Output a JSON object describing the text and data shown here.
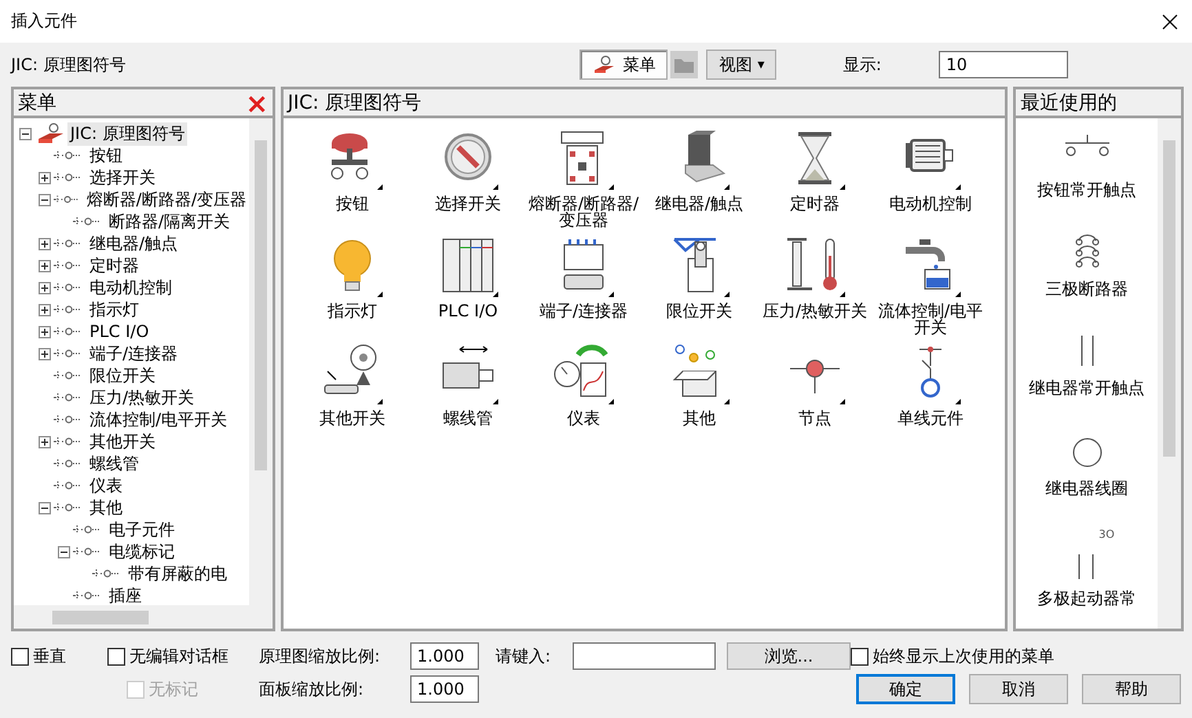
{
  "window": {
    "title": "插入元件"
  },
  "toolbar": {
    "library": "JIC: 原理图符号",
    "menu_button": {
      "label": "菜单",
      "selected": true
    },
    "view_button": {
      "label": "视图",
      "arrow": "▾"
    },
    "display": {
      "label": "显示:",
      "value": "10"
    }
  },
  "menu_panel": {
    "title": "菜单",
    "close": "×",
    "tree": [
      {
        "label": "JIC: 原理图符号",
        "expanded": true,
        "selected": true,
        "children": [
          {
            "label": "按钮"
          },
          {
            "label": "选择开关",
            "expanded": false
          },
          {
            "label": "熔断器/断路器/变压器",
            "expanded": true,
            "children": [
              {
                "label": "断路器/隔离开关"
              }
            ]
          },
          {
            "label": "继电器/触点",
            "expanded": false
          },
          {
            "label": "定时器",
            "expanded": false
          },
          {
            "label": "电动机控制",
            "expanded": false
          },
          {
            "label": "指示灯",
            "expanded": false
          },
          {
            "label": "PLC I/O",
            "expanded": false
          },
          {
            "label": "端子/连接器",
            "expanded": false
          },
          {
            "label": "限位开关"
          },
          {
            "label": "压力/热敏开关"
          },
          {
            "label": "流体控制/电平开关"
          },
          {
            "label": "其他开关",
            "expanded": false
          },
          {
            "label": "螺线管"
          },
          {
            "label": "仪表"
          },
          {
            "label": "其他",
            "expanded": true,
            "children": [
              {
                "label": "电子元件"
              },
              {
                "label": "电缆标记",
                "expanded": true,
                "children": [
                  {
                    "label": "带有屏蔽的电"
                  }
                ]
              },
              {
                "label": "插座"
              }
            ]
          }
        ]
      }
    ]
  },
  "symbols_panel": {
    "title": "JIC: 原理图符号",
    "items": [
      {
        "label": "按钮"
      },
      {
        "label": "选择开关"
      },
      {
        "label": "熔断器/断路器/变压器"
      },
      {
        "label": "继电器/触点"
      },
      {
        "label": "定时器"
      },
      {
        "label": "电动机控制"
      },
      {
        "label": "指示灯"
      },
      {
        "label": "PLC I/O"
      },
      {
        "label": "端子/连接器"
      },
      {
        "label": "限位开关"
      },
      {
        "label": "压力/热敏开关"
      },
      {
        "label": "流体控制/电平开关"
      },
      {
        "label": "其他开关"
      },
      {
        "label": "螺线管"
      },
      {
        "label": "仪表"
      },
      {
        "label": "其他"
      },
      {
        "label": "节点"
      },
      {
        "label": "单线元件"
      }
    ]
  },
  "recent_panel": {
    "title": "最近使用的",
    "items": [
      {
        "label": "按钮常开触点"
      },
      {
        "label": "三极断路器"
      },
      {
        "label": "继电器常开触点"
      },
      {
        "label": "继电器线圈"
      },
      {
        "label": "多极起动器常",
        "symbol_text": "3O"
      }
    ]
  },
  "options": {
    "vertical": {
      "label": "垂直",
      "checked": false
    },
    "no_edit_dialog": {
      "label": "无编辑对话框",
      "checked": false
    },
    "no_tag": {
      "label": "无标记",
      "checked": false,
      "disabled": true
    },
    "schematic_scale": {
      "label": "原理图缩放比例:",
      "value": "1.000"
    },
    "panel_scale": {
      "label": "面板缩放比例:",
      "value": "1.000"
    },
    "type_in": {
      "label": "请键入:"
    },
    "browse": "浏览...",
    "always_show": {
      "label": "始终显示上次使用的菜单",
      "checked": false
    }
  },
  "buttons": {
    "ok": "确定",
    "cancel": "取消",
    "help": "帮助"
  }
}
